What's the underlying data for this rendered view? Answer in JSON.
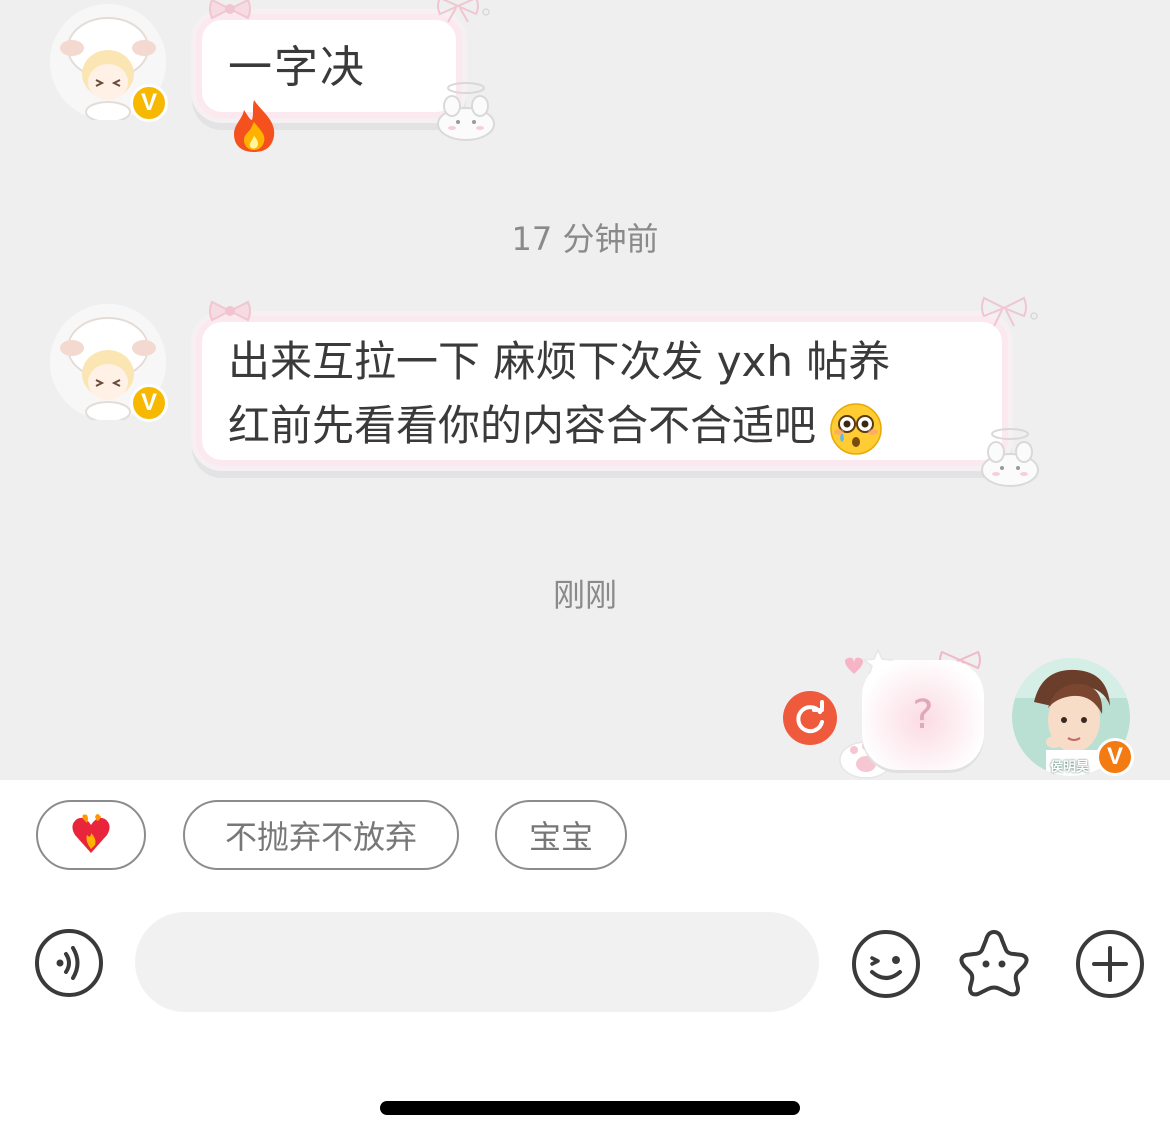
{
  "messages": [
    {
      "sender": "other",
      "text": "一字决",
      "emoji": "fire-emoji"
    },
    {
      "sender": "other",
      "line1": "出来互拉一下 麻烦下次发 yxh 帖养",
      "line2": "红前先看看你的内容合不合适吧",
      "emoji": "flushed-tearful-emoji"
    },
    {
      "sender": "self",
      "text": "?",
      "status": "resend-icon"
    }
  ],
  "timestamps": [
    "17 分钟前",
    "刚刚"
  ],
  "self_avatar": {
    "name_tag": "侯明昊"
  },
  "quick_replies": [
    {
      "label": "",
      "icon": "burning-heart-icon"
    },
    {
      "label": "不抛弃不放弃"
    },
    {
      "label": "宝宝"
    }
  ],
  "input": {
    "value": "",
    "placeholder": ""
  },
  "toolbar": {
    "voice_icon": "voice-icon",
    "emoji_icon": "emoji-icon",
    "sticker_icon": "star-sticker-icon",
    "more_icon": "plus-icon"
  },
  "colors": {
    "chat_bg": "#efefef",
    "badge_yellow": "#f6b800",
    "badge_orange": "#f47a12",
    "resend_red": "#f05a3c",
    "bubble_border_pink": "#fbe9ef"
  }
}
